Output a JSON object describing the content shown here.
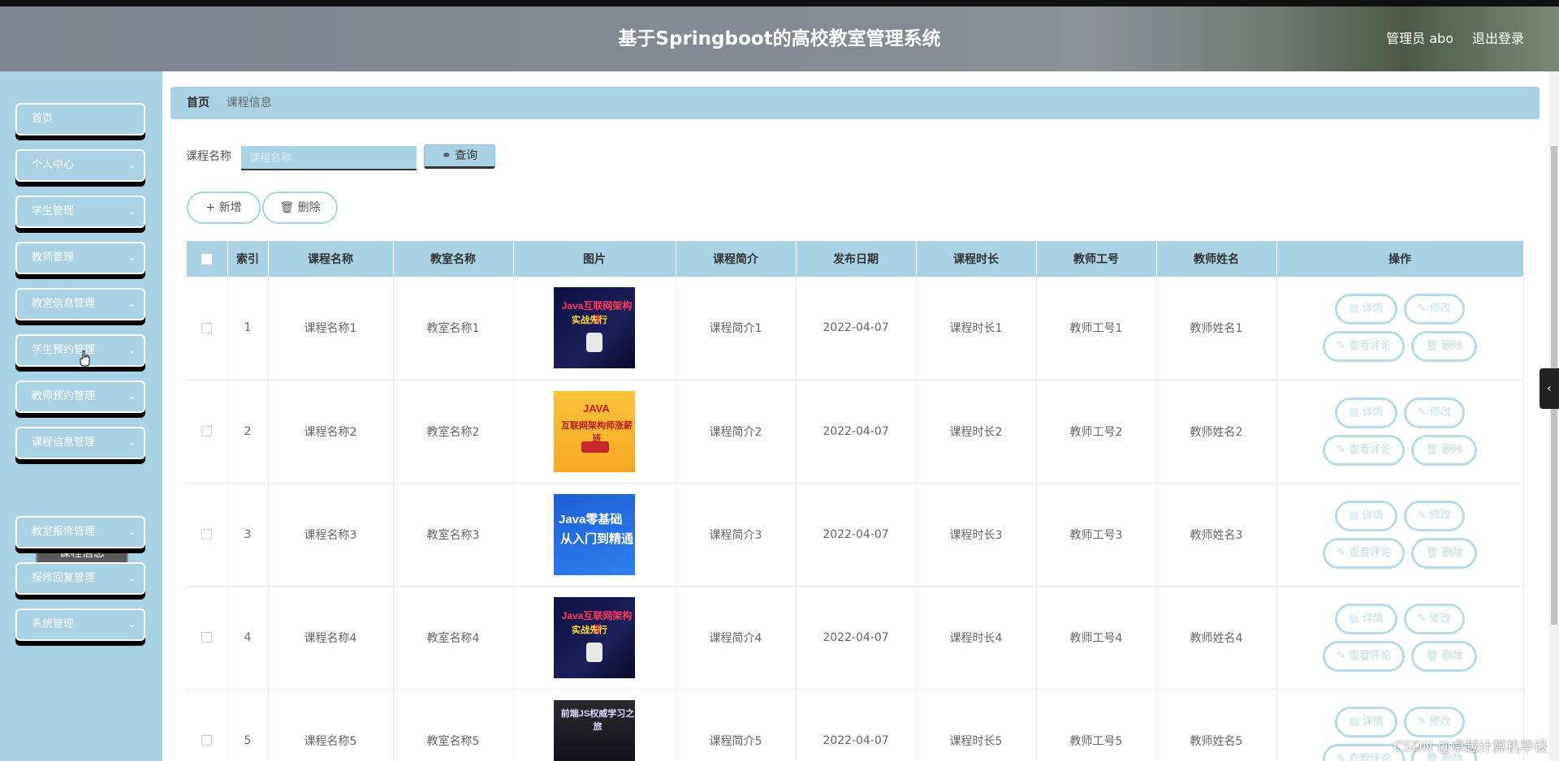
{
  "header": {
    "title": "基于Springboot的高校教室管理系统",
    "user": "管理员 abo",
    "logout": "退出登录"
  },
  "sidebar": {
    "items": [
      {
        "label": "首页",
        "chevron": false
      },
      {
        "label": "个人中心",
        "chevron": true
      },
      {
        "label": "学生管理",
        "chevron": true
      },
      {
        "label": "教师管理",
        "chevron": true
      },
      {
        "label": "教室信息管理",
        "chevron": true
      },
      {
        "label": "学生预约管理",
        "chevron": true
      },
      {
        "label": "教师预约管理",
        "chevron": true
      },
      {
        "label": "课程信息管理",
        "chevron": true
      },
      {
        "label": "教室报修管理",
        "chevron": true
      },
      {
        "label": "报修回复管理",
        "chevron": true
      },
      {
        "label": "系统管理",
        "chevron": true
      }
    ],
    "submenu_active": "课程信息"
  },
  "breadcrumb": {
    "home": "首页",
    "separator": "/",
    "current": "课程信息"
  },
  "search": {
    "label": "课程名称",
    "placeholder": "课程名称",
    "button": "查询"
  },
  "actions": {
    "add": "新增",
    "delete": "删除"
  },
  "table": {
    "headers": [
      "索引",
      "课程名称",
      "教室名称",
      "图片",
      "课程简介",
      "发布日期",
      "课程时长",
      "教师工号",
      "教师姓名",
      "操作"
    ],
    "rows": [
      {
        "index": "1",
        "course": "课程名称1",
        "room": "教室名称1",
        "intro": "课程简介1",
        "date": "2022-04-07",
        "duration": "课程时长1",
        "teacher_id": "教师工号1",
        "teacher_name": "教师姓名1",
        "img": "a",
        "img_t1": "Java互联网架构师",
        "img_t2": "实战先行"
      },
      {
        "index": "2",
        "course": "课程名称2",
        "room": "教室名称2",
        "intro": "课程简介2",
        "date": "2022-04-07",
        "duration": "课程时长2",
        "teacher_id": "教师工号2",
        "teacher_name": "教师姓名2",
        "img": "b",
        "img_t1": "JAVA",
        "img_t2": "互联网架构师涨薪班"
      },
      {
        "index": "3",
        "course": "课程名称3",
        "room": "教室名称3",
        "intro": "课程简介3",
        "date": "2022-04-07",
        "duration": "课程时长3",
        "teacher_id": "教师工号3",
        "teacher_name": "教师姓名3",
        "img": "c",
        "img_t1": "Java零基础",
        "img_t2": "从入门到精通"
      },
      {
        "index": "4",
        "course": "课程名称4",
        "room": "教室名称4",
        "intro": "课程简介4",
        "date": "2022-04-07",
        "duration": "课程时长4",
        "teacher_id": "教师工号4",
        "teacher_name": "教师姓名4",
        "img": "a",
        "img_t1": "Java互联网架构师",
        "img_t2": "实战先行"
      },
      {
        "index": "5",
        "course": "课程名称5",
        "room": "教室名称5",
        "intro": "课程简介5",
        "date": "2022-04-07",
        "duration": "课程时长5",
        "teacher_id": "教师工号5",
        "teacher_name": "教师姓名5",
        "img": "d",
        "img_t1": "前端JS权威学习之旅",
        "img_t2": ""
      }
    ],
    "ops": {
      "detail": "详情",
      "edit": "修改",
      "comments": "查看评论",
      "delete": "删除"
    }
  },
  "watermark": "CSDN @卓越计算机毕设",
  "colors": {
    "accent": "#a9d3e5",
    "header_bg": "#808890",
    "submenu_bg": "#5a5a5a"
  }
}
